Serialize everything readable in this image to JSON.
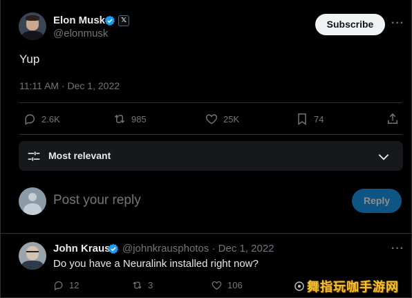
{
  "tweet": {
    "author_name": "Elon Musk",
    "author_handle": "@elonmusk",
    "subscribe_label": "Subscribe",
    "text": "Yup",
    "timestamp": "11:11 AM · Dec 1, 2022",
    "stats": {
      "replies": "2.6K",
      "retweets": "985",
      "likes": "25K",
      "bookmarks": "74"
    }
  },
  "sort": {
    "label": "Most relevant"
  },
  "composer": {
    "placeholder": "Post your reply",
    "reply_label": "Reply"
  },
  "reply": {
    "author_name": "John Kraus",
    "meta": "@johnkrausphotos · Dec 1, 2022",
    "text": "Do you have a Neuralink installed right now?",
    "stats": {
      "replies": "12",
      "retweets": "3",
      "likes": "106"
    }
  },
  "watermark": {
    "text": "舞指玩咖手游网"
  },
  "colors": {
    "background": "#000000",
    "text_primary": "#e7e9ea",
    "text_secondary": "#71767b",
    "accent": "#1d9bf0",
    "divider": "#2f3336"
  },
  "icons": [
    "verified-badge-icon",
    "x-logo-icon",
    "more-icon",
    "reply-icon",
    "retweet-icon",
    "like-icon",
    "bookmark-icon",
    "share-icon",
    "filter-icon",
    "chevron-down-icon"
  ]
}
